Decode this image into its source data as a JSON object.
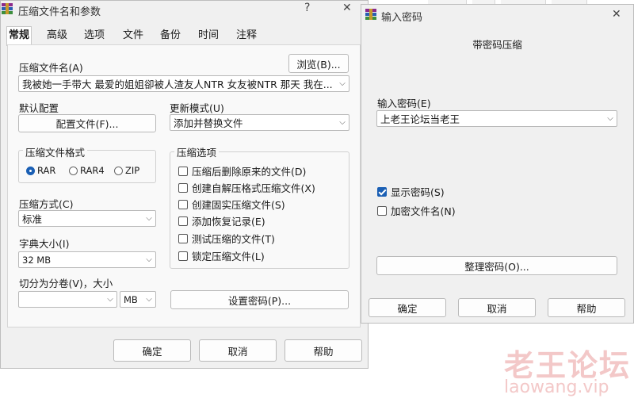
{
  "main_window": {
    "title": "压缩文件名和参数",
    "help_glyph": "?",
    "close_glyph": "✕",
    "tabs": [
      "常规",
      "高级",
      "选项",
      "文件",
      "备份",
      "时间",
      "注释"
    ],
    "archive_name_label": "压缩文件名(A)",
    "browse_label": "浏览(B)...",
    "archive_name_value": "我被她一手带大 最爱的姐姐卻被人渣友人NTR 女友被NTR 那天 我在...",
    "default_profile_label": "默认配置",
    "profiles_button": "配置文件(F)...",
    "update_mode_label": "更新模式(U)",
    "update_mode_value": "添加并替换文件",
    "archive_format_label": "压缩文件格式",
    "formats": [
      "RAR",
      "RAR4",
      "ZIP"
    ],
    "selected_format": "RAR",
    "compression_method_label": "压缩方式(C)",
    "compression_method_value": "标准",
    "dictionary_size_label": "字典大小(I)",
    "dictionary_size_value": "32 MB",
    "split_label": "切分为分卷(V)，大小",
    "split_value": "",
    "split_unit": "MB",
    "options_label": "压缩选项",
    "options": [
      {
        "label": "压缩后删除原来的文件(D)",
        "checked": false
      },
      {
        "label": "创建自解压格式压缩文件(X)",
        "checked": false
      },
      {
        "label": "创建固实压缩文件(S)",
        "checked": false
      },
      {
        "label": "添加恢复记录(E)",
        "checked": false
      },
      {
        "label": "测试压缩的文件(T)",
        "checked": false
      },
      {
        "label": "锁定压缩文件(L)",
        "checked": false
      }
    ],
    "set_password_button": "设置密码(P)...",
    "ok_button": "确定",
    "cancel_button": "取消",
    "help_button": "帮助"
  },
  "password_dialog": {
    "title": "输入密码",
    "close_glyph": "✕",
    "heading": "带密码压缩",
    "enter_password_label": "输入密码(E)",
    "password_value": "上老王论坛当老王",
    "show_password_label": "显示密码(S)",
    "show_password_checked": true,
    "encrypt_names_label": "加密文件名(N)",
    "encrypt_names_checked": false,
    "organize_button": "整理密码(O)...",
    "ok_button": "确定",
    "cancel_button": "取消",
    "help_button": "帮助"
  },
  "watermark": {
    "title": "老王论坛",
    "url": "laowang.vip"
  },
  "colors": {
    "accent": "#1a5fb4",
    "watermark": "#f3c8c8",
    "window_bg": "#f0f0f0"
  }
}
